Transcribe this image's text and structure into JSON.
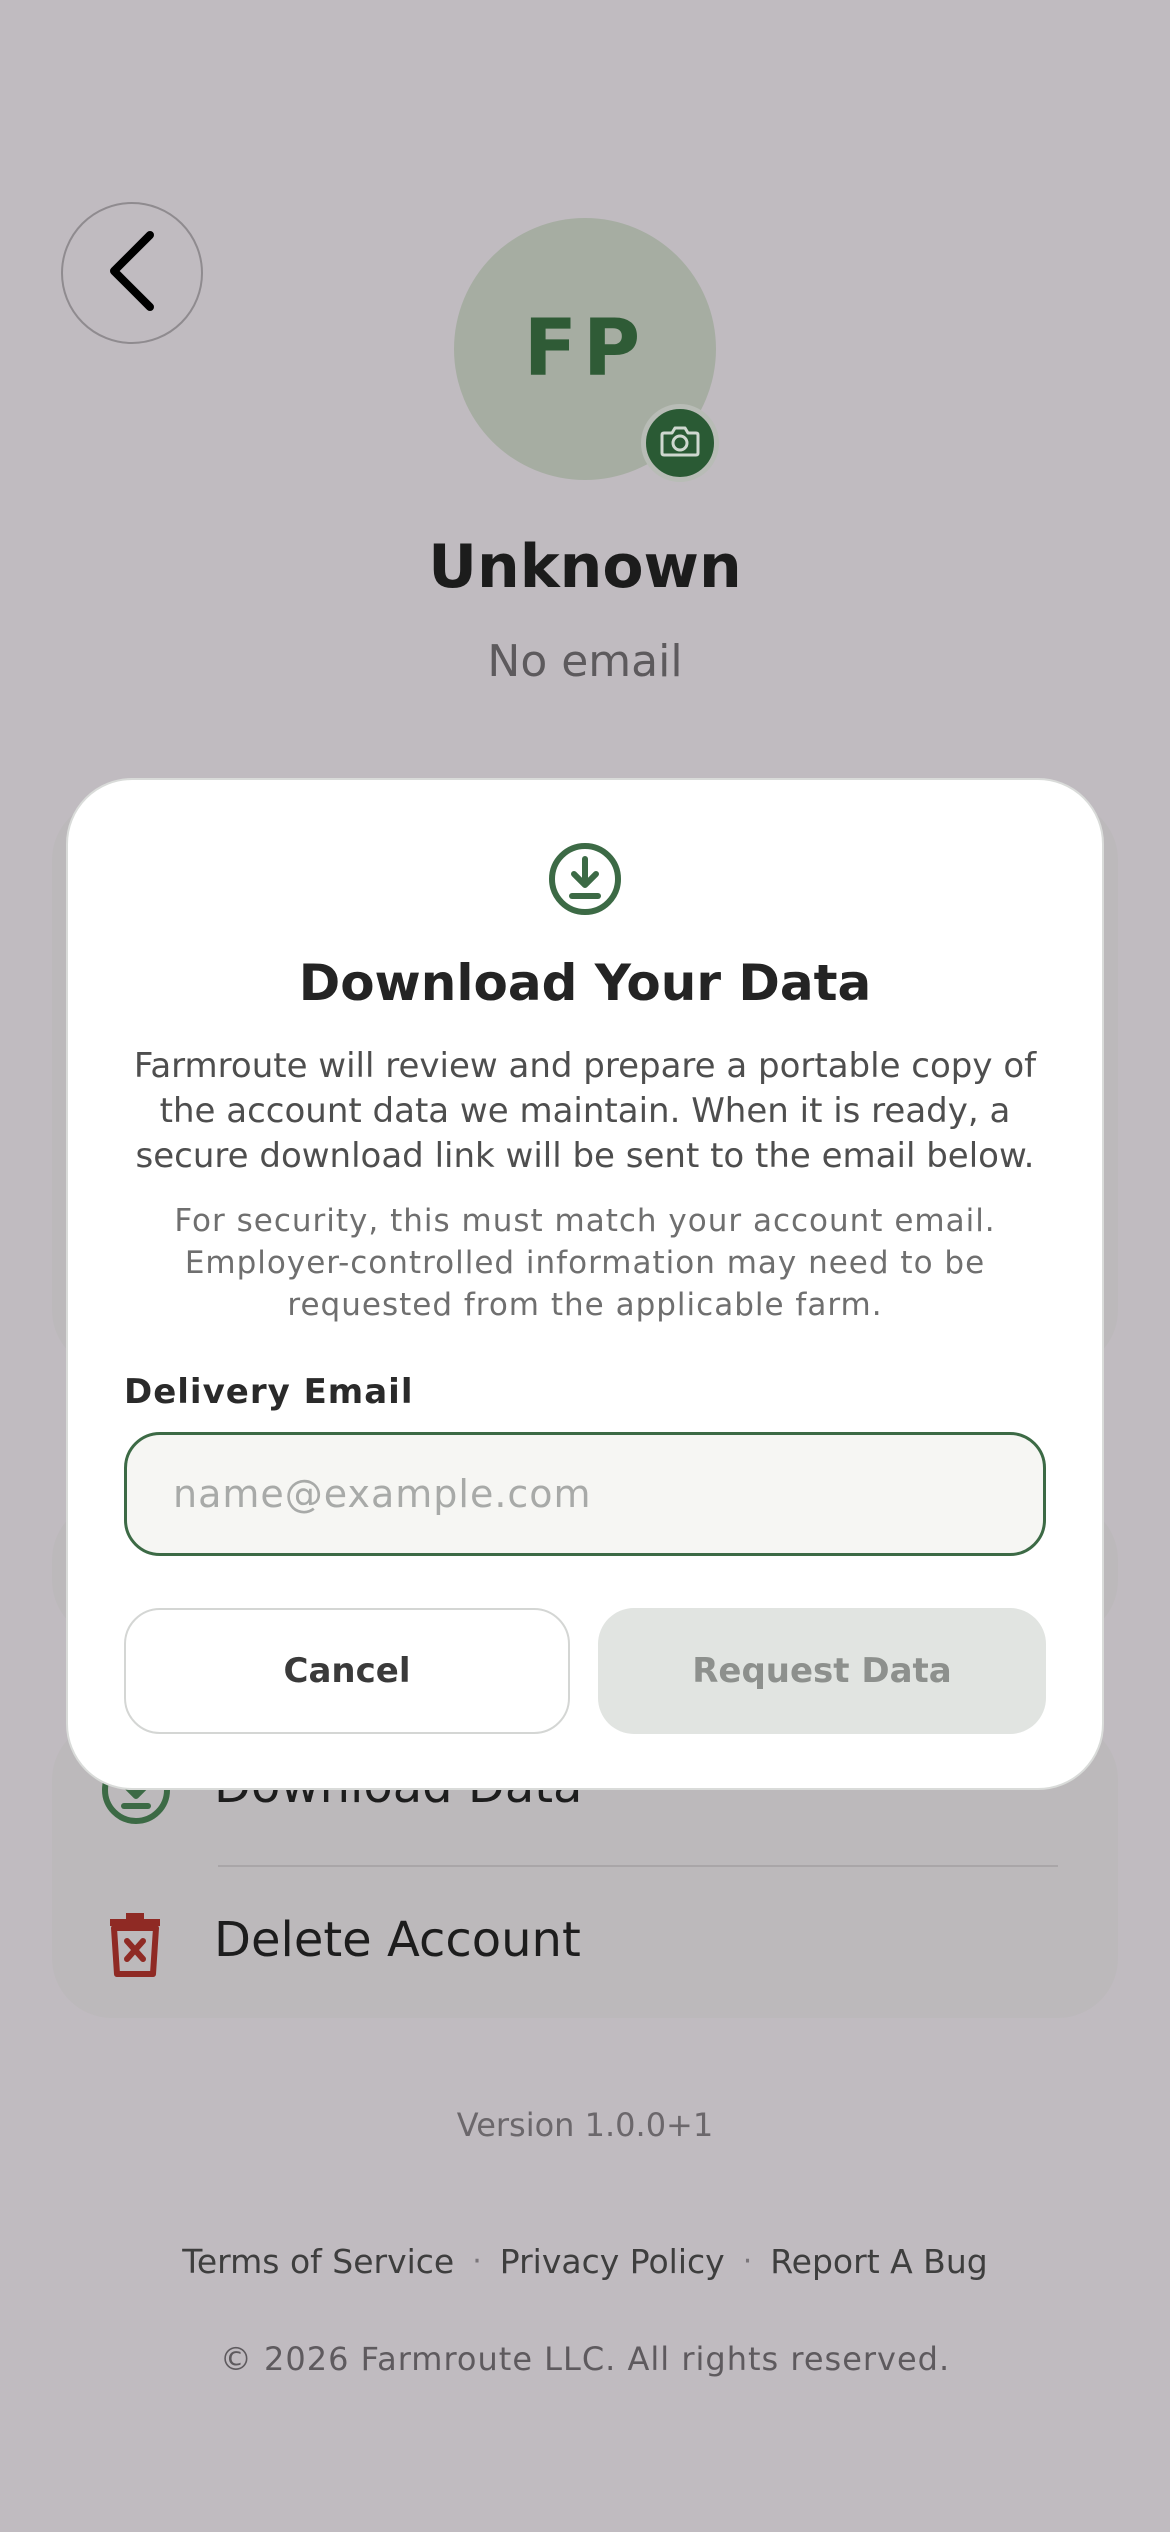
{
  "profile": {
    "initials": "FP",
    "name": "Unknown",
    "email": "No email"
  },
  "icons": {
    "back": "chevron-left-icon",
    "camera": "camera-icon",
    "download": "download-icon",
    "delete": "trash-icon"
  },
  "colors": {
    "accent": "#2a5a34",
    "danger": "#8f2a24",
    "avatar_bg": "#a6ada2"
  },
  "settings": {
    "download_label": "Download Data",
    "delete_label": "Delete Account"
  },
  "footer": {
    "version": "Version 1.0.0+1",
    "links": [
      "Terms of Service",
      "Privacy Policy",
      "Report A Bug"
    ],
    "separator": "·",
    "copyright": "© 2026 Farmroute LLC. All rights reserved."
  },
  "modal": {
    "title": "Download Your Data",
    "body": "Farmroute will review and prepare a portable copy of the account data we maintain. When it is ready, a secure download link will be sent to the email below.",
    "note": "For security, this must match your account email. Employer-controlled information may need to be requested from the applicable farm.",
    "field_label": "Delivery Email",
    "field_value": "",
    "field_placeholder": "name@example.com",
    "cancel_label": "Cancel",
    "request_label": "Request Data"
  }
}
